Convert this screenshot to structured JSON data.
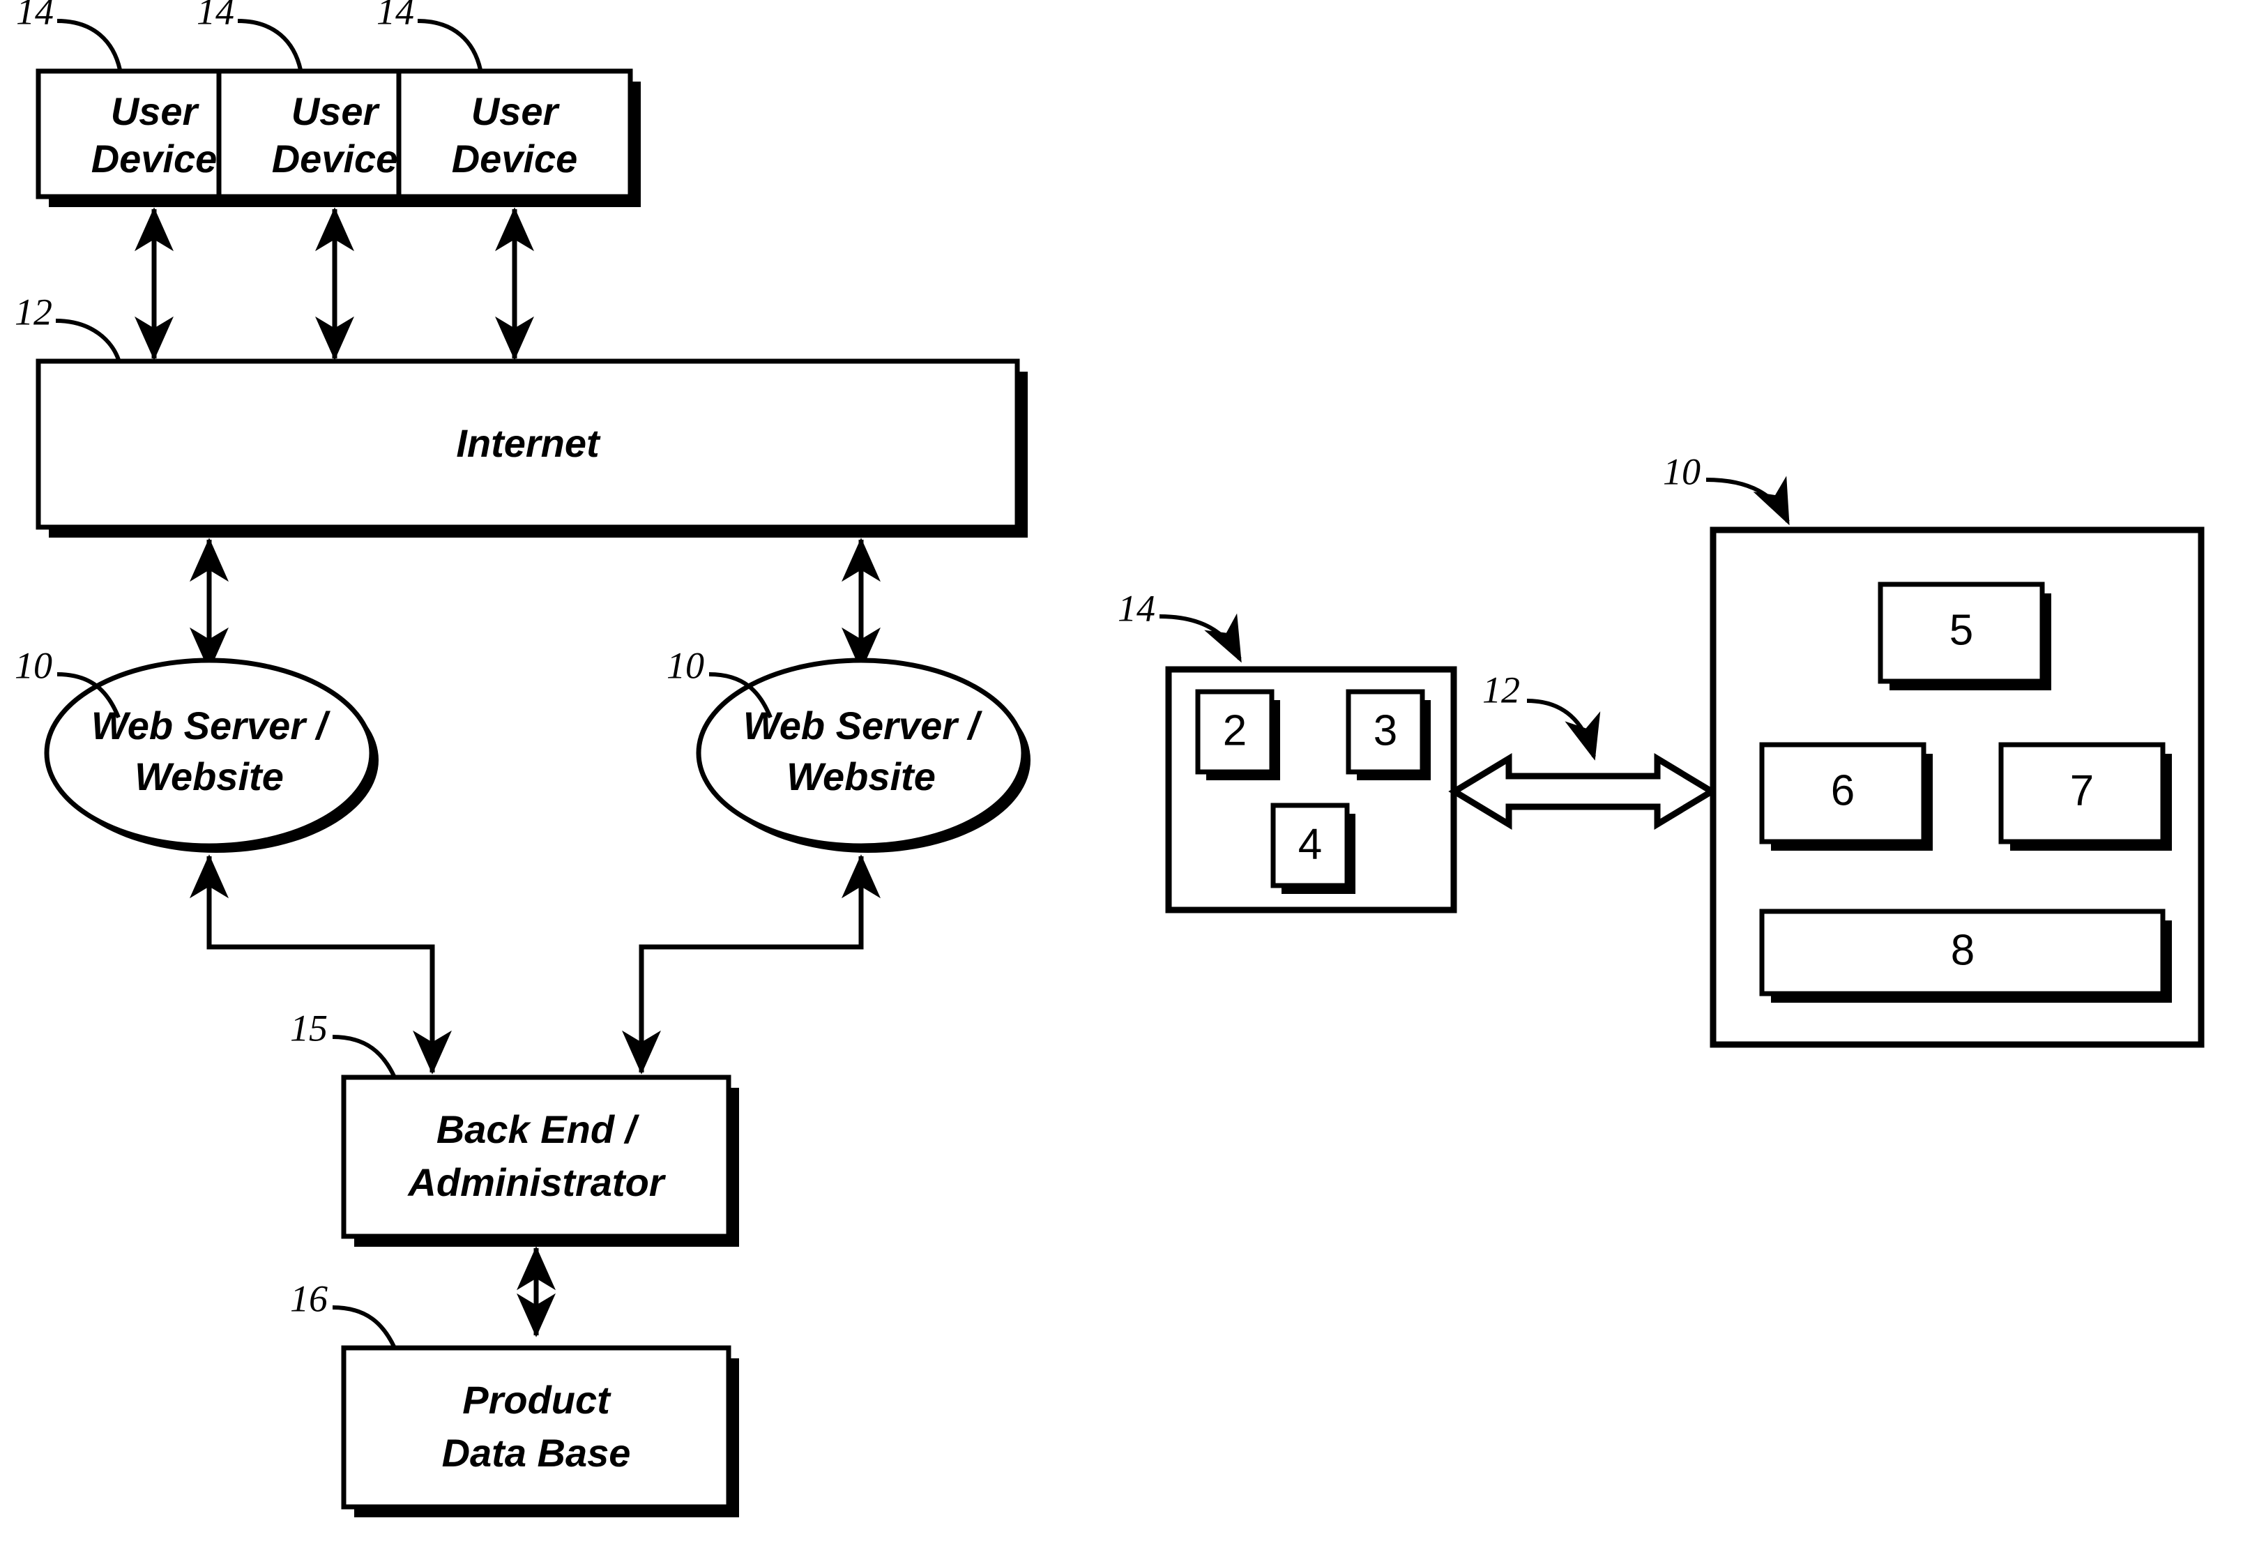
{
  "figure": {
    "title": "Network system block diagram",
    "background_color": "#ffffff",
    "line_color": "#000000"
  },
  "left_diagram": {
    "user_devices": [
      {
        "label": "User\nDevice",
        "line1": "User",
        "line2": "Device",
        "ref": "14"
      },
      {
        "label": "User\nDevice",
        "line1": "User",
        "line2": "Device",
        "ref": "14"
      },
      {
        "label": "User\nDevice",
        "line1": "User",
        "line2": "Device",
        "ref": "14"
      }
    ],
    "internet": {
      "label": "Internet",
      "ref": "12"
    },
    "web_servers": [
      {
        "line1": "Web Server /",
        "line2": "Website",
        "ref": "10"
      },
      {
        "line1": "Web Server /",
        "line2": "Website",
        "ref": "10"
      }
    ],
    "back_end": {
      "line1": "Back End /",
      "line2": "Administrator",
      "ref": "15"
    },
    "product_database": {
      "line1": "Product",
      "line2": "Data Base",
      "ref": "16"
    }
  },
  "right_diagram": {
    "device": {
      "ref": "14",
      "components": [
        {
          "number": "2"
        },
        {
          "number": "3"
        },
        {
          "number": "4"
        }
      ]
    },
    "link": {
      "ref": "12",
      "kind": "bidirectional-block-arrow"
    },
    "server": {
      "ref": "10",
      "components": [
        {
          "number": "5"
        },
        {
          "number": "6"
        },
        {
          "number": "7"
        },
        {
          "number": "8"
        }
      ]
    }
  }
}
